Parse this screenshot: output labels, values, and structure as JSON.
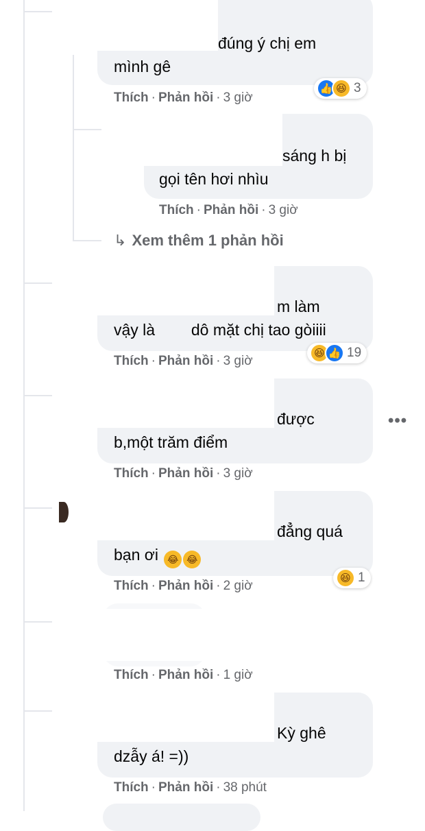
{
  "comments": [
    {
      "line1": "đúng ý chị em",
      "line2": "mình gê",
      "like": "Thích",
      "reply": "Phản hồi",
      "time": "3 giờ",
      "reaction_icons": [
        "like-icon",
        "haha-icon"
      ],
      "reaction_count": "3"
    },
    {
      "line1": "sáng h bị",
      "line2": "gọi tên hơi nhìu",
      "like": "Thích",
      "reply": "Phản hồi",
      "time": "3 giờ"
    },
    {
      "line1": "m làm",
      "line2": "vậy là",
      "line2b": "dô mặt chị tao gòiiii",
      "like": "Thích",
      "reply": "Phản hồi",
      "time": "3 giờ",
      "reaction_icons": [
        "haha-icon",
        "like-icon"
      ],
      "reaction_count": "19"
    },
    {
      "line1": "được",
      "line2": "b,một trăm điểm",
      "like": "Thích",
      "reply": "Phản hồi",
      "time": "3 giờ"
    },
    {
      "line1": "đẳng quá",
      "line2": "bạn ơi",
      "like": "Thích",
      "reply": "Phản hồi",
      "time": "2 giờ",
      "reaction_icons": [
        "haha-icon"
      ],
      "reaction_count": "1"
    },
    {
      "like": "Thích",
      "reply": "Phản hồi",
      "time": "1 giờ"
    },
    {
      "line1": "Kỳ ghê",
      "line2": "dzẫy á! =))",
      "like": "Thích",
      "reply": "Phản hồi",
      "time": "38 phút"
    }
  ],
  "see_more": "Xem thêm 1 phản hồi",
  "separator": "·",
  "colors": {
    "bubble": "#f0f2f5",
    "meta": "#65676b",
    "like": "#1877f2",
    "haha": "#f7b928"
  }
}
